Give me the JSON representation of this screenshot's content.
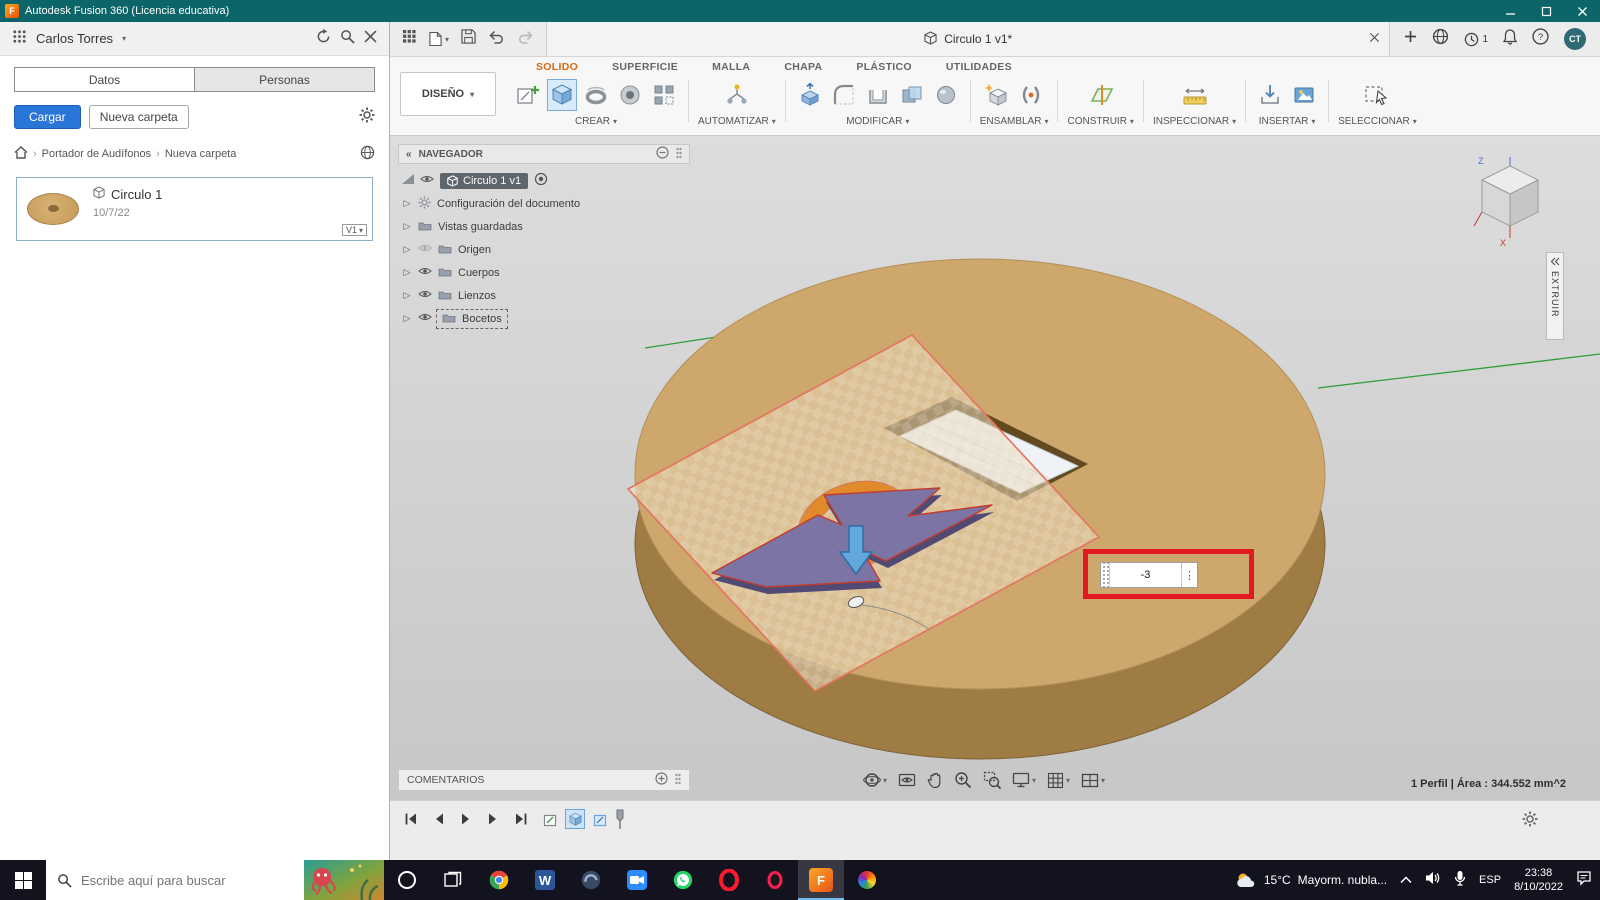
{
  "icons": {
    "caret_down": "▾",
    "breadcrumb_separator": "›",
    "collapse_left": "«",
    "overflow_dots": "⋮",
    "fusion_glyph": "F",
    "word_glyph": "W",
    "help_glyph": "?"
  },
  "title_bar": {
    "app_title": "Autodesk Fusion 360 (Licencia educativa)"
  },
  "data_panel": {
    "user_name": "Carlos Torres",
    "tab_datos": "Datos",
    "tab_personas": "Personas",
    "upload_button": "Cargar",
    "new_folder_button": "Nueva carpeta",
    "breadcrumb_root": "Portador de Audífonos",
    "breadcrumb_current": "Nueva carpeta",
    "item_name": "Circulo 1",
    "item_date": "10/7/22",
    "item_version": "V1"
  },
  "quickbar": {
    "doc_tab_title": "Circulo 1 v1*",
    "notifications_badge": "1",
    "avatar_initials": "CT"
  },
  "ribbon": {
    "design_menu_label": "DISEÑO",
    "tabs": [
      "SOLIDO",
      "SUPERFICIE",
      "MALLA",
      "CHAPA",
      "PLÁSTICO",
      "UTILIDADES"
    ],
    "groups": {
      "crear": "CREAR",
      "automatizar": "AUTOMATIZAR",
      "modificar": "MODIFICAR",
      "ensamblar": "ENSAMBLAR",
      "construir": "CONSTRUIR",
      "inspeccionar": "INSPECCIONAR",
      "insertar": "INSERTAR",
      "seleccionar": "SELECCIONAR"
    }
  },
  "browser": {
    "panel_title": "NAVEGADOR",
    "root_node": "Circulo 1 v1",
    "nodes": {
      "document_settings": "Configuración del documento",
      "named_views": "Vistas guardadas",
      "origin": "Origen",
      "bodies": "Cuerpos",
      "canvases": "Lienzos",
      "sketches": "Bocetos"
    }
  },
  "viewport": {
    "dimension_value": "-3",
    "comments_panel_title": "COMENTARIOS",
    "extrude_side_tab": "EXTRUIR",
    "status_text": "1 Perfil | Área : 344.552 mm^2",
    "viewcube_axis_z": "Z",
    "viewcube_axis_x": "X"
  },
  "taskbar": {
    "search_placeholder": "Escribe aquí para buscar",
    "weather_temp": "15°C",
    "weather_condition": "Mayorm. nubla...",
    "input_language": "ESP",
    "clock_time": "23:38",
    "clock_date": "8/10/2022"
  }
}
